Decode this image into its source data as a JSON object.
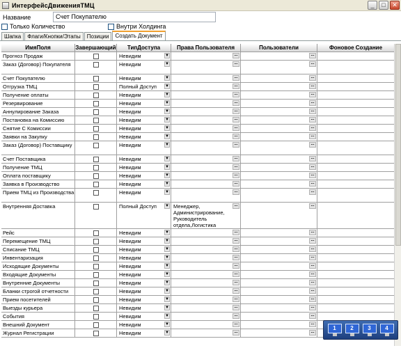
{
  "window": {
    "title": "ИнтерфейсДвиженияТМЦ"
  },
  "form": {
    "name_label": "Название",
    "name_value": "Счет Покупателю",
    "only_qty_label": "Только Количество",
    "holding_label": "Внутри Холдинга"
  },
  "tabs": [
    {
      "label": "Шапка",
      "active": false
    },
    {
      "label": "Флаги/Кнопки/Этапы",
      "active": false
    },
    {
      "label": "Позиции",
      "active": false
    },
    {
      "label": "Создать Документ",
      "active": true
    }
  ],
  "grid": {
    "columns": [
      "ИмяПоля",
      "Завершающий",
      "ТипДоступа",
      "Права Пользователя",
      "Пользователи",
      "Фоновое Создание"
    ],
    "rows": [
      {
        "name": "Прогноз Продаж",
        "type": "Невидим",
        "rights": ""
      },
      {
        "name": "Заказ (Договор) Покупателя",
        "type": "Невидим",
        "rights": ""
      },
      {
        "name": "Счет Покупателю",
        "type": "Невидим",
        "rights": ""
      },
      {
        "name": "Отгрузка ТМЦ",
        "type": "Полный Доступ",
        "rights": ""
      },
      {
        "name": "Получение оплаты",
        "type": "Невидим",
        "rights": ""
      },
      {
        "name": "Резервирование",
        "type": "Невидим",
        "rights": ""
      },
      {
        "name": "Аннулирование Заказа",
        "type": "Невидим",
        "rights": ""
      },
      {
        "name": "Постановка на Комиссию",
        "type": "Невидим",
        "rights": ""
      },
      {
        "name": "Снятие С Комиссии",
        "type": "Невидим",
        "rights": ""
      },
      {
        "name": "Заявки на Закупку",
        "type": "Невидим",
        "rights": ""
      },
      {
        "name": "Заказ (Договор) Поставщику",
        "type": "Невидим",
        "rights": ""
      },
      {
        "name": "Счет Поставщика",
        "type": "Невидим",
        "rights": ""
      },
      {
        "name": "Получение ТМЦ",
        "type": "Невидим",
        "rights": ""
      },
      {
        "name": "Оплата поставщику",
        "type": "Невидим",
        "rights": ""
      },
      {
        "name": "Заявка в Производство",
        "type": "Невидим",
        "rights": ""
      },
      {
        "name": "Прием ТМЦ из Производства",
        "type": "Невидим",
        "rights": ""
      },
      {
        "name": "Внутренняя Доставка",
        "type": "Полный Доступ",
        "rights": "Менеджер, Администрирование, Руководитель отдела,Логистика"
      },
      {
        "name": "Рейс",
        "type": "Невидим",
        "rights": ""
      },
      {
        "name": "Перемещение ТМЦ",
        "type": "Невидим",
        "rights": ""
      },
      {
        "name": "Списание ТМЦ",
        "type": "Невидим",
        "rights": ""
      },
      {
        "name": "Инвентаризация",
        "type": "Невидим",
        "rights": ""
      },
      {
        "name": "Исходящие Документы",
        "type": "Невидим",
        "rights": ""
      },
      {
        "name": "Входящие Документы",
        "type": "Невидим",
        "rights": ""
      },
      {
        "name": "Внутренние Документы",
        "type": "Невидим",
        "rights": ""
      },
      {
        "name": "Бланки строгой отчетности",
        "type": "Невидим",
        "rights": ""
      },
      {
        "name": "Прием посетителей",
        "type": "Невидим",
        "rights": ""
      },
      {
        "name": "Выезды курьера",
        "type": "Невидим",
        "rights": ""
      },
      {
        "name": "События",
        "type": "Невидим",
        "rights": ""
      },
      {
        "name": "Внешний Документ",
        "type": "Невидим",
        "rights": ""
      },
      {
        "name": "Журнал Регистрации",
        "type": "Невидим",
        "rights": ""
      }
    ]
  },
  "monitors": [
    "1",
    "2",
    "3",
    "4"
  ]
}
